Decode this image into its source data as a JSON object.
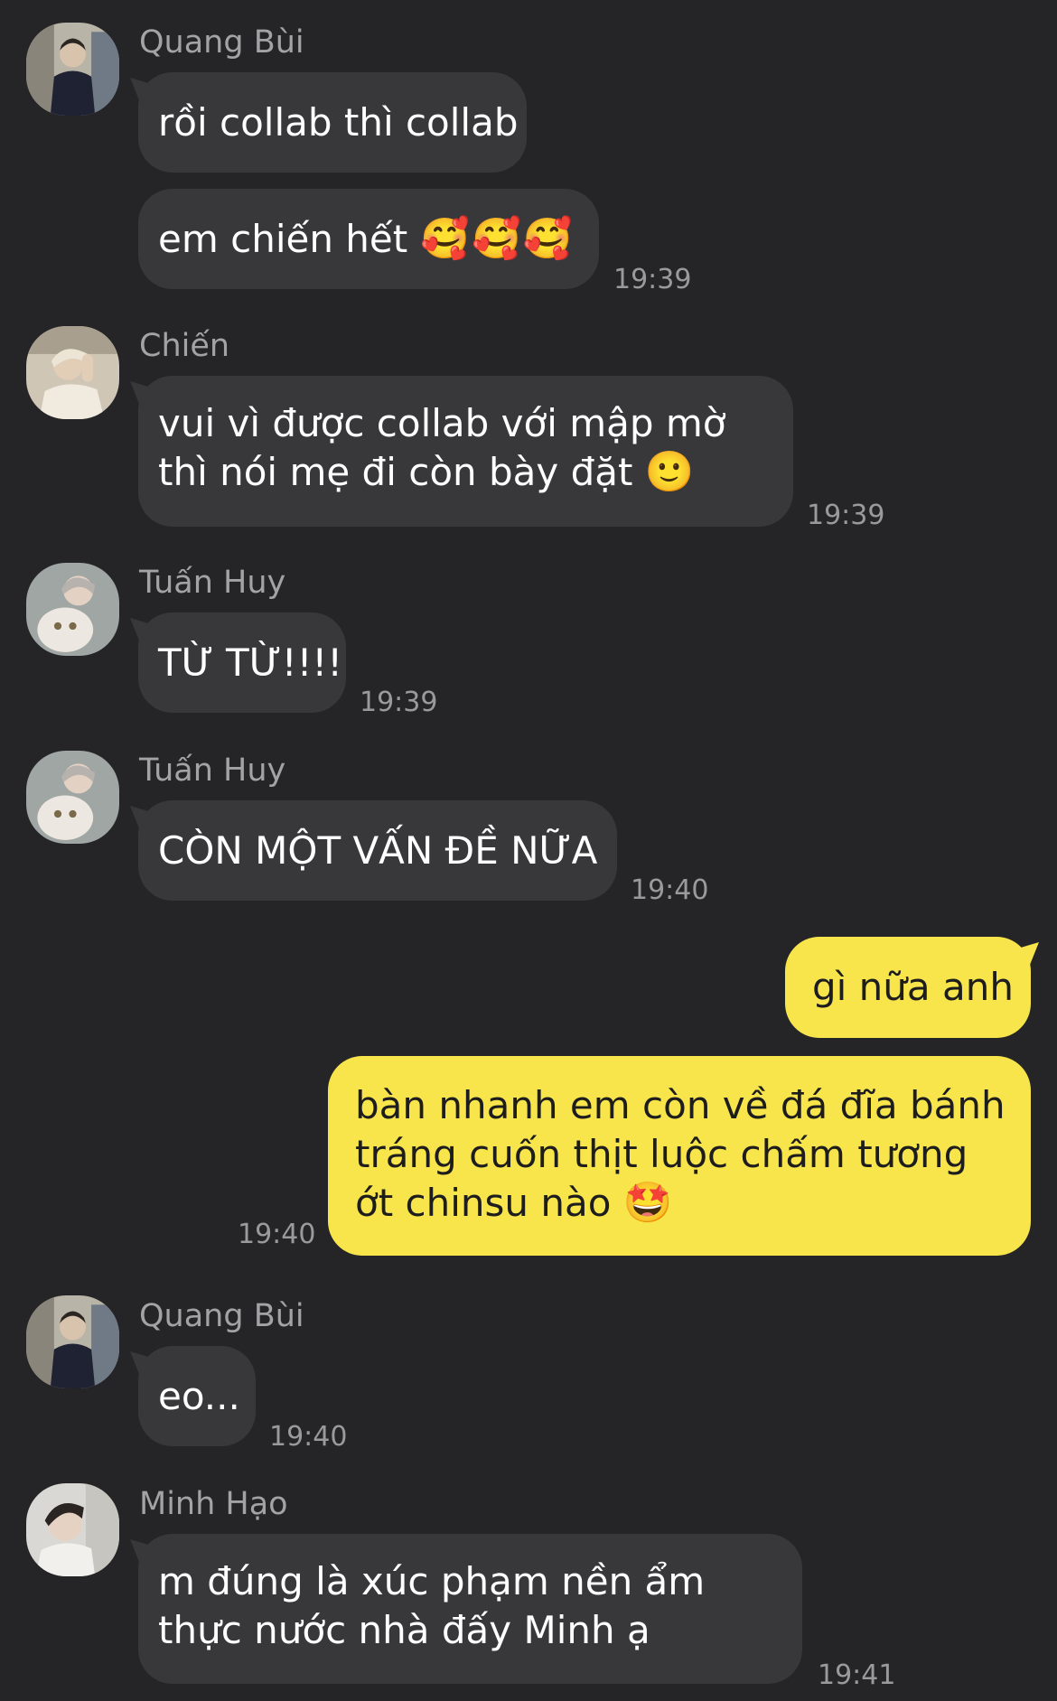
{
  "messages": [
    {
      "sender": "Quang Bùi",
      "avatar": "avatar-quang-bui",
      "text": "rồi collab thì collab"
    },
    {
      "text": "em chiến hết",
      "emoji": "🥰🥰🥰",
      "time": "19:39"
    },
    {
      "sender": "Chiến",
      "avatar": "avatar-chien",
      "text": "vui vì được collab với mập mờ thì nói mẹ đi còn bày đặt",
      "emoji": "🙂",
      "time": "19:39"
    },
    {
      "sender": "Tuấn Huy",
      "avatar": "avatar-tuan-huy",
      "text": "TỪ TỪ!!!!",
      "time": "19:39"
    },
    {
      "sender": "Tuấn Huy",
      "avatar": "avatar-tuan-huy",
      "text": "CÒN MỘT VẤN ĐỀ NỮA",
      "time": "19:40"
    },
    {
      "outgoing": true,
      "text": "gì nữa anh"
    },
    {
      "outgoing": true,
      "text": "bàn nhanh em còn về đá đĩa bánh tráng cuốn thịt luộc chấm tương ớt chinsu nào",
      "emoji": "🤩",
      "time": "19:40"
    },
    {
      "sender": "Quang Bùi",
      "avatar": "avatar-quang-bui",
      "text": "eo...",
      "time": "19:40"
    },
    {
      "sender": "Minh Hạo",
      "avatar": "avatar-minh-hao",
      "text": "m đúng là xúc phạm nền ẩm thực nước nhà đấy Minh ạ",
      "time": "19:41"
    }
  ],
  "colors": {
    "background": "#252527",
    "incoming_bubble": "#38383b",
    "outgoing_bubble": "#f8e54b",
    "sender_name": "#a3a3a6",
    "timestamp": "#9a9a9d"
  }
}
